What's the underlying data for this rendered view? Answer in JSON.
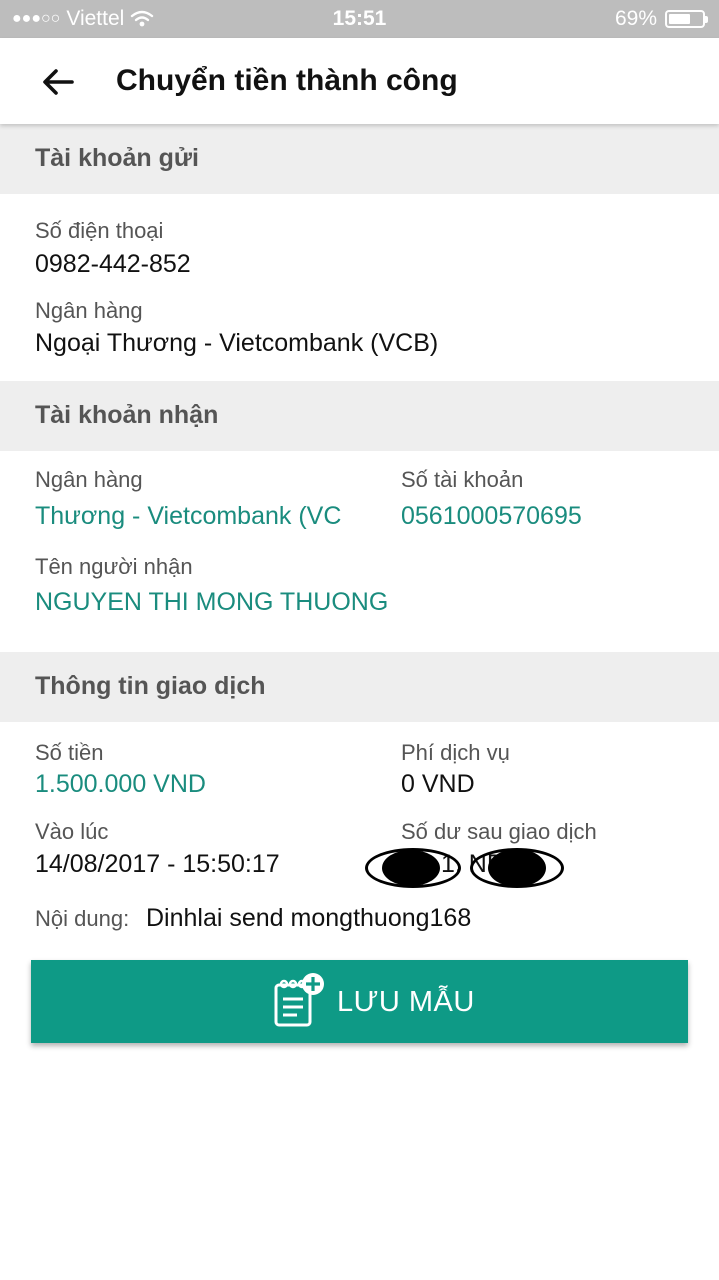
{
  "status_bar": {
    "signal_dots": "●●●○○",
    "carrier": "Viettel",
    "time": "15:51",
    "battery_percent": "69%",
    "battery_level": 0.69
  },
  "header": {
    "title": "Chuyển tiền thành công"
  },
  "sender": {
    "section_title": "Tài khoản gửi",
    "phone_label": "Số điện thoại",
    "phone_value": "0982-442-852",
    "bank_label": "Ngân hàng",
    "bank_value": "Ngoại Thương - Vietcombank (VCB)"
  },
  "receiver": {
    "section_title": "Tài khoản nhận",
    "bank_label": "Ngân hàng",
    "bank_value": "Thương - Vietcombank (VC",
    "account_label": "Số tài khoản",
    "account_value": "0561000570695",
    "name_label": "Tên người nhận",
    "name_value": "NGUYEN THI MONG THUONG"
  },
  "transaction": {
    "section_title": "Thông tin giao dịch",
    "amount_label": "Số tiền",
    "amount_value": "1.500.000 VND",
    "fee_label": "Phí dịch vụ",
    "fee_value": "0 VND",
    "time_label": "Vào lúc",
    "time_value": "14/08/2017 - 15:50:17",
    "balance_label": "Số dư sau giao dịch",
    "balance_value": "1.   ND",
    "content_label": "Nội dung:",
    "content_value": "Dinhlai send mongthuong168"
  },
  "actions": {
    "save_template_label": "LƯU MẪU"
  },
  "colors": {
    "accent": "#0e9a86",
    "teal_text": "#1a8c7e",
    "section_bg": "#eeeeee",
    "status_bar_bg": "#bdbdbd"
  }
}
